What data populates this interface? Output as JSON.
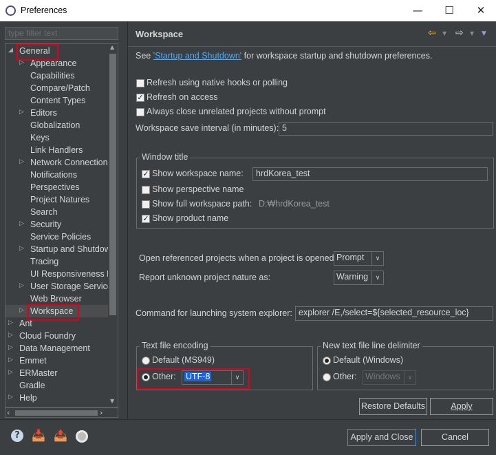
{
  "window": {
    "title": "Preferences",
    "controls": [
      "—",
      "☐",
      "✕"
    ]
  },
  "filter": {
    "placeholder": "type filter text"
  },
  "tree": {
    "items": [
      {
        "label": "General",
        "level": 0,
        "expandable": true,
        "expanded": true,
        "highlighted": true
      },
      {
        "label": "Appearance",
        "level": 1,
        "expandable": true
      },
      {
        "label": "Capabilities",
        "level": 1
      },
      {
        "label": "Compare/Patch",
        "level": 1
      },
      {
        "label": "Content Types",
        "level": 1
      },
      {
        "label": "Editors",
        "level": 1,
        "expandable": true
      },
      {
        "label": "Globalization",
        "level": 1
      },
      {
        "label": "Keys",
        "level": 1
      },
      {
        "label": "Link Handlers",
        "level": 1
      },
      {
        "label": "Network Connection",
        "level": 1,
        "expandable": true
      },
      {
        "label": "Notifications",
        "level": 1
      },
      {
        "label": "Perspectives",
        "level": 1
      },
      {
        "label": "Project Natures",
        "level": 1
      },
      {
        "label": "Search",
        "level": 1
      },
      {
        "label": "Security",
        "level": 1,
        "expandable": true
      },
      {
        "label": "Service Policies",
        "level": 1
      },
      {
        "label": "Startup and Shutdow",
        "level": 1,
        "expandable": true
      },
      {
        "label": "Tracing",
        "level": 1
      },
      {
        "label": "UI Responsiveness M",
        "level": 1
      },
      {
        "label": "User Storage Service",
        "level": 1,
        "expandable": true
      },
      {
        "label": "Web Browser",
        "level": 1
      },
      {
        "label": "Workspace",
        "level": 1,
        "expandable": true,
        "selected": true,
        "highlighted": true
      },
      {
        "label": "Ant",
        "level": 0,
        "expandable": true
      },
      {
        "label": "Cloud Foundry",
        "level": 0,
        "expandable": true
      },
      {
        "label": "Data Management",
        "level": 0,
        "expandable": true
      },
      {
        "label": "Emmet",
        "level": 0,
        "expandable": true
      },
      {
        "label": "ERMaster",
        "level": 0,
        "expandable": true
      },
      {
        "label": "Gradle",
        "level": 0
      },
      {
        "label": "Help",
        "level": 0,
        "expandable": true
      }
    ]
  },
  "page": {
    "title": "Workspace",
    "intro_prefix": "See ",
    "intro_link": "'Startup and Shutdown'",
    "intro_suffix": " for workspace startup and shutdown preferences.",
    "refresh_native": {
      "label": "Refresh using native hooks or polling",
      "checked": false
    },
    "refresh_access": {
      "label": "Refresh on access",
      "checked": true
    },
    "always_close": {
      "label": "Always close unrelated projects without prompt",
      "checked": false
    },
    "save_interval": {
      "label": "Workspace save interval (in minutes):",
      "value": "5"
    },
    "window_title": {
      "legend": "Window title",
      "show_workspace_name": {
        "label": "Show workspace name:",
        "checked": true,
        "value": "hrdKorea_test"
      },
      "show_perspective_name": {
        "label": "Show perspective name",
        "checked": false
      },
      "show_full_path": {
        "label": "Show full workspace path:",
        "checked": false,
        "value": "D:₩hrdKorea_test"
      },
      "show_product_name": {
        "label": "Show product name",
        "checked": true
      }
    },
    "open_referenced": {
      "label": "Open referenced projects when a project is opened:",
      "value": "Prompt"
    },
    "report_unknown": {
      "label": "Report unknown project nature as:",
      "value": "Warning"
    },
    "system_explorer": {
      "label": "Command for launching system explorer:",
      "value": "explorer /E,/select=${selected_resource_loc}"
    },
    "encoding": {
      "legend": "Text file encoding",
      "default_label": "Default (MS949)",
      "other_label": "Other:",
      "other_value": "UTF-8",
      "selected": "other"
    },
    "line_delimiter": {
      "legend": "New text file line delimiter",
      "default_label": "Default (Windows)",
      "other_label": "Other:",
      "other_value": "Windows",
      "selected": "default"
    },
    "restore_defaults": "Restore Defaults",
    "apply": "Apply"
  },
  "footer": {
    "apply_close": "Apply and Close",
    "cancel": "Cancel"
  },
  "colors": {
    "background": "#3c3f41",
    "highlight": "#e0001b",
    "link": "#5aa8e8",
    "selection": "#1a64d8"
  }
}
